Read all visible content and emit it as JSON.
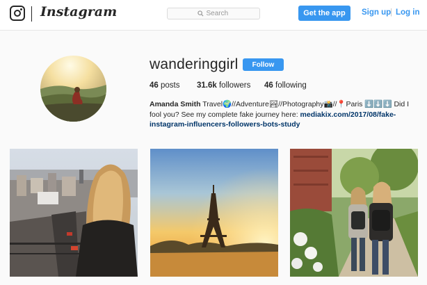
{
  "header": {
    "brand": "Instagram",
    "search_placeholder": "Search",
    "get_app_label": "Get the app",
    "signup_label": "Sign up",
    "separator": "|",
    "login_label": "Log in"
  },
  "profile": {
    "username": "wanderinggirl",
    "follow_label": "Follow",
    "posts_count": "46",
    "posts_label": "posts",
    "followers_count": "31.6k",
    "followers_label": "followers",
    "following_count": "46",
    "following_label": "following",
    "bio_name": "Amanda Smith",
    "bio_line": "Travel🌍//Adventure🏞//Photography📸//📍Paris ⬇️⬇️⬇️ Did I fool you? See my complete fake journey here:",
    "bio_link": "mediakix.com/2017/08/fake-instagram-influencers-followers-bots-study"
  },
  "colors": {
    "accent": "#3897f0",
    "link": "#003569",
    "background": "#fafafa"
  },
  "icons": [
    "instagram-camera-icon",
    "search-icon"
  ],
  "posts": [
    {
      "description": "city-view-blonde-woman"
    },
    {
      "description": "eiffel-tower-sunset"
    },
    {
      "description": "two-women-backpacks-path"
    }
  ]
}
